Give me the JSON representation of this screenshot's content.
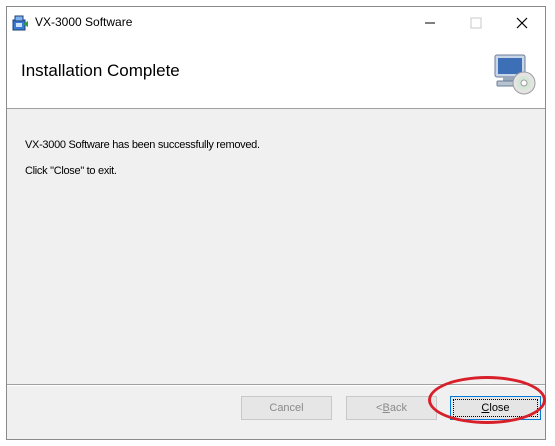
{
  "window": {
    "title": "VX-3000 Software"
  },
  "header": {
    "heading": "Installation Complete"
  },
  "content": {
    "message1": "VX-3000 Software has been successfully removed.",
    "message2": "Click \"Close\" to exit."
  },
  "buttons": {
    "cancel": "Cancel",
    "back_mnemonic": "B",
    "back_rest": "ack",
    "back_prefix": "< ",
    "close_mnemonic": "C",
    "close_rest": "lose"
  },
  "icons": {
    "app": "installer-icon",
    "header": "computer-cd-icon",
    "minimize": "minimize-icon",
    "maximize": "maximize-icon",
    "close": "close-icon"
  },
  "colors": {
    "highlight_ring": "#d8202a",
    "focus_border": "#0078d7"
  }
}
